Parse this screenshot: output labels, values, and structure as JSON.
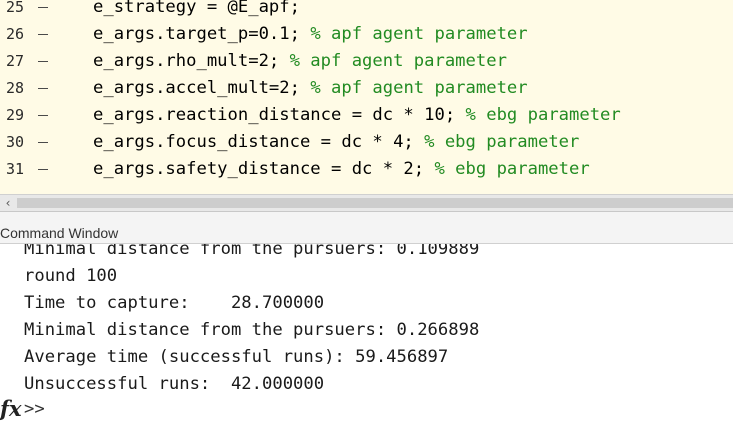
{
  "editor": {
    "lines": [
      {
        "num": "25",
        "code": "e_strategy = @E_apf;",
        "comment": ""
      },
      {
        "num": "26",
        "code": "e_args.target_p=0.1; ",
        "comment": "% apf agent parameter"
      },
      {
        "num": "27",
        "code": "e_args.rho_mult=2; ",
        "comment": "% apf agent parameter"
      },
      {
        "num": "28",
        "code": "e_args.accel_mult=2; ",
        "comment": "% apf agent parameter"
      },
      {
        "num": "29",
        "code": "e_args.reaction_distance = dc * 10; ",
        "comment": "% ebg parameter"
      },
      {
        "num": "30",
        "code": "e_args.focus_distance = dc * 4; ",
        "comment": "% ebg parameter"
      },
      {
        "num": "31",
        "code": "e_args.safety_distance = dc * 2; ",
        "comment": "% ebg parameter"
      }
    ]
  },
  "scrollbar": {
    "left_arrow": "‹"
  },
  "command_window": {
    "title": "Command Window",
    "output": [
      "Minimal distance from the pursuers: 0.109889",
      "round 100",
      "Time to capture:    28.700000",
      "Minimal distance from the pursuers: 0.266898",
      "Average time (successful runs): 59.456897",
      "Unsuccessful runs:  42.000000"
    ],
    "fx_label": "fx",
    "prompt": ">>"
  },
  "colors": {
    "editor_bg": "#fffbe6",
    "comment": "#228b22",
    "scroll_thumb": "#cdcdcd"
  }
}
